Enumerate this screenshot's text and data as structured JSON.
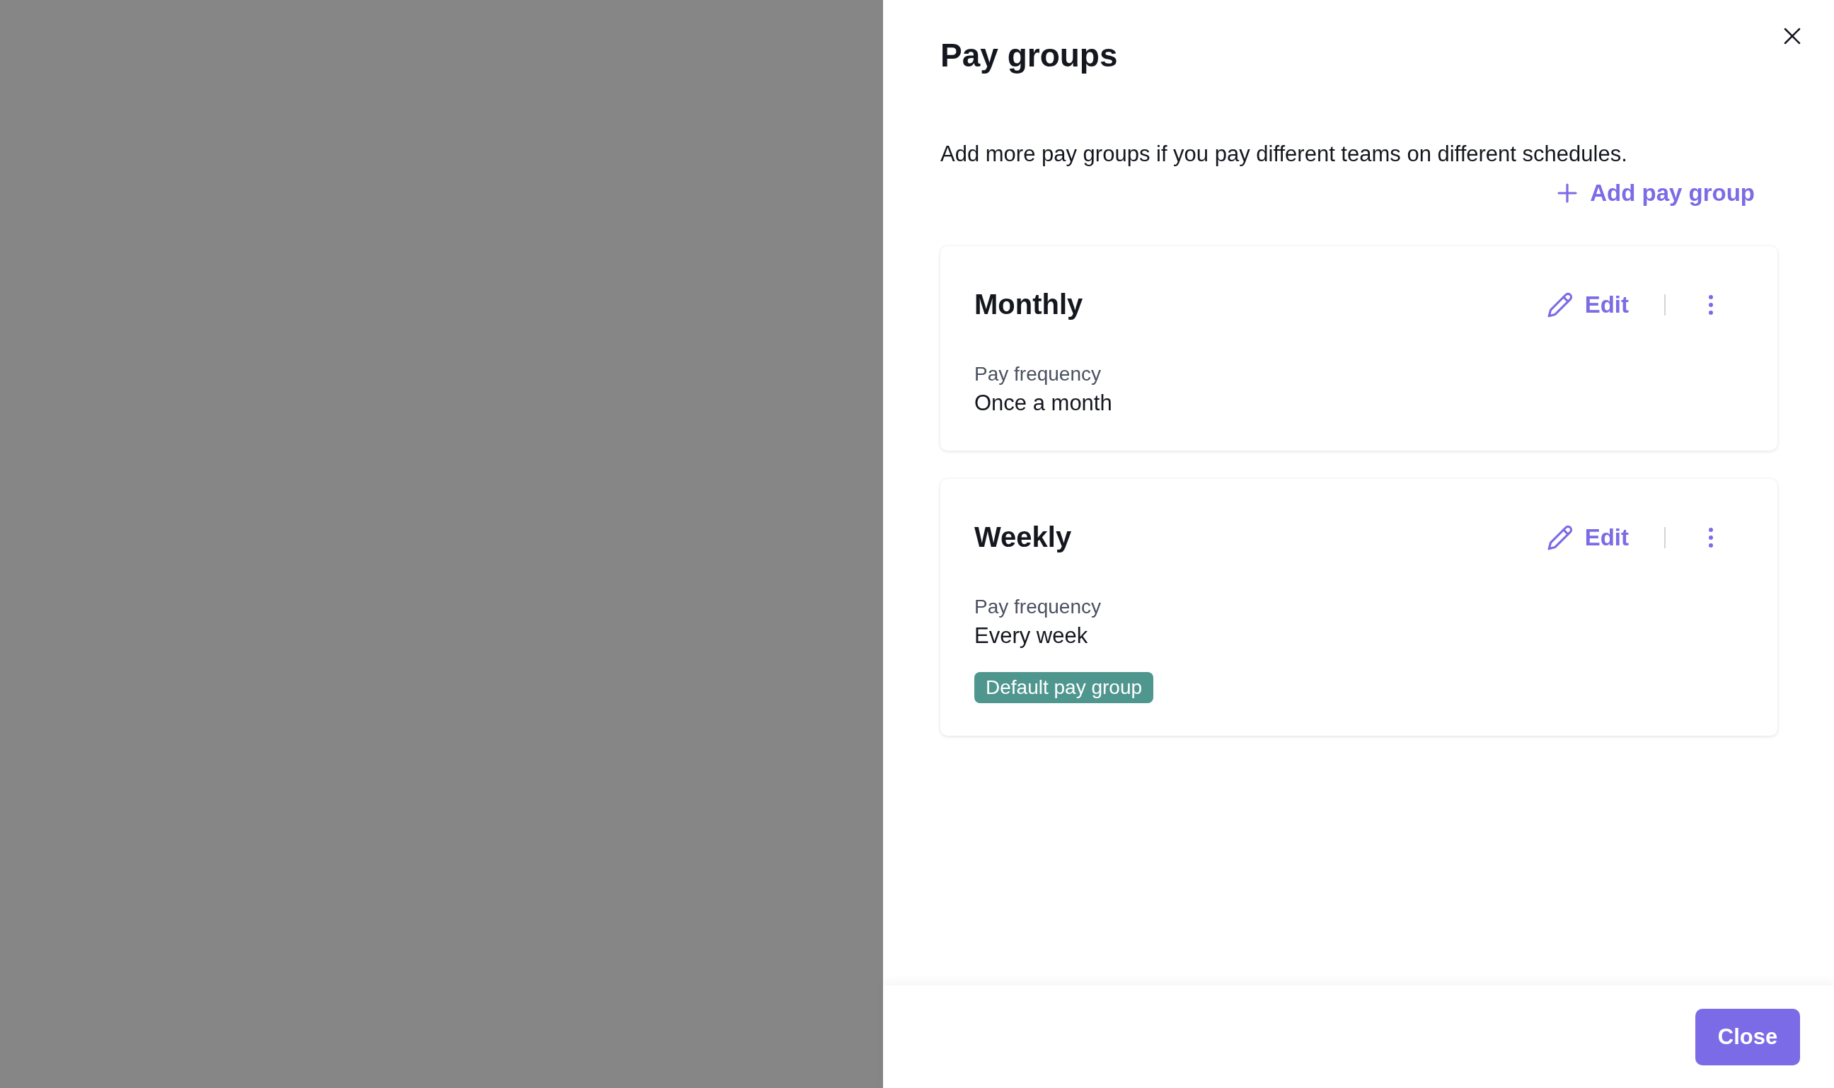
{
  "panel": {
    "title": "Pay groups",
    "description": "Add more pay groups if you pay different teams on different schedules.",
    "add_button": "Add pay group"
  },
  "pay_groups": [
    {
      "name": "Monthly",
      "edit_label": "Edit",
      "field_label": "Pay frequency",
      "frequency": "Once a month"
    },
    {
      "name": "Weekly",
      "edit_label": "Edit",
      "field_label": "Pay frequency",
      "frequency": "Every week",
      "badge": "Default pay group"
    }
  ],
  "footer": {
    "close_button": "Close"
  }
}
